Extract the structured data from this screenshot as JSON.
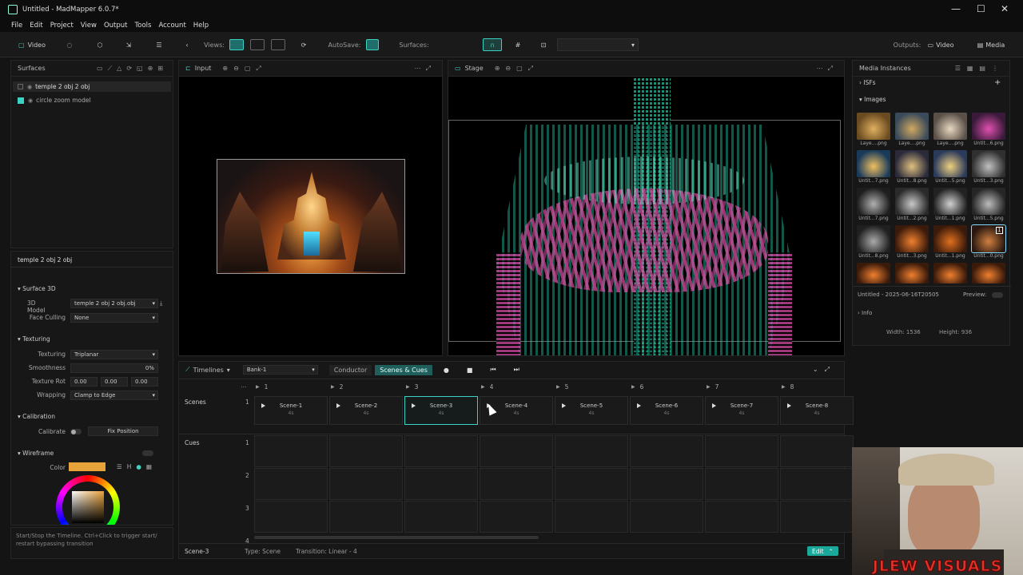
{
  "window": {
    "title": "Untitled - MadMapper 6.0.7*",
    "min": "—",
    "max": "☐",
    "close": "✕"
  },
  "menu": [
    "File",
    "Edit",
    "Project",
    "View",
    "Output",
    "Tools",
    "Account",
    "Help"
  ],
  "toolbar": {
    "video": "Video",
    "views_label": "Views:",
    "autosave_label": "AutoSave:",
    "surfaces_label": "Surfaces:",
    "outputs_label": "Outputs:",
    "outputs_video": "Video",
    "media": "Media"
  },
  "surfaces": {
    "title": "Surfaces",
    "items": [
      {
        "label": "temple 2 obj 2 obj",
        "color": "#2a2a2a"
      },
      {
        "label": "circle zoom model",
        "color": "#3bd4c4"
      }
    ]
  },
  "props": {
    "selected": "temple 2 obj 2 obj",
    "surface3d": "Surface 3D",
    "model_label": "3D Model",
    "model_value": "temple 2 obj 2 obj.obj",
    "face_label": "Face Culling",
    "face_value": "None",
    "texturing": "Texturing",
    "tex_label": "Texturing",
    "tex_value": "Triplanar",
    "smooth_label": "Smoothness",
    "smooth_value": "0%",
    "rot_label": "Texture Rot",
    "rot_x": "0.00",
    "rot_y": "0.00",
    "rot_z": "0.00",
    "wrap_label": "Wrapping",
    "wrap_value": "Clamp to Edge",
    "calibration": "Calibration",
    "calibrate": "Calibrate",
    "fix_position": "Fix Position",
    "wireframe": "Wireframe",
    "color_label": "Color",
    "color": "#e8a23a",
    "hint": "Start/Stop the Timeline. Ctrl+Click to trigger start/ restart bypassing transition"
  },
  "input": {
    "title": "Input"
  },
  "stage": {
    "title": "Stage"
  },
  "media": {
    "title": "Media Instances",
    "isf": "ISFs",
    "images": "Images",
    "thumbs": [
      "Laye....png",
      "Laye....png",
      "Laye....png",
      "Untit...6.png",
      "Untit...7.png",
      "Untit...8.png",
      "Untit...5.png",
      "Untit...3.png",
      "Untit...7.png",
      "Untit...2.png",
      "Untit...1.png",
      "Untit...5.png",
      "Untit...8.png",
      "Untit...3.png",
      "Untit...1.png",
      "Untit...0.png"
    ],
    "selected_name": "Untitled - 2025-06-16T20505",
    "preview": "Preview:",
    "info": "Info",
    "width": "Width: 1536",
    "height": "Height: 936",
    "badge": "1"
  },
  "timeline": {
    "title": "Timelines",
    "bank": "Bank-1",
    "conductor": "Conductor",
    "scenes_cues": "Scenes & Cues",
    "columns": [
      "1",
      "2",
      "3",
      "4",
      "5",
      "6",
      "7",
      "8"
    ],
    "scenes_label": "Scenes",
    "scenes_row": "1",
    "scenes": [
      {
        "name": "Scene-1",
        "dur": "4s"
      },
      {
        "name": "Scene-2",
        "dur": "4s"
      },
      {
        "name": "Scene-3",
        "dur": "4s"
      },
      {
        "name": "Scene-4",
        "dur": "4s"
      },
      {
        "name": "Scene-5",
        "dur": "4s"
      },
      {
        "name": "Scene-6",
        "dur": "4s"
      },
      {
        "name": "Scene-7",
        "dur": "4s"
      },
      {
        "name": "Scene-8",
        "dur": "4s"
      }
    ],
    "cues_label": "Cues",
    "cue_rows": [
      "1",
      "2",
      "3",
      "4"
    ],
    "footer_scene": "Scene-3",
    "footer_type": "Type:  Scene",
    "footer_transition": "Transition:  Linear - 4",
    "edit": "Edit"
  },
  "webcam": {
    "watermark": "JLEW VISUALS"
  }
}
